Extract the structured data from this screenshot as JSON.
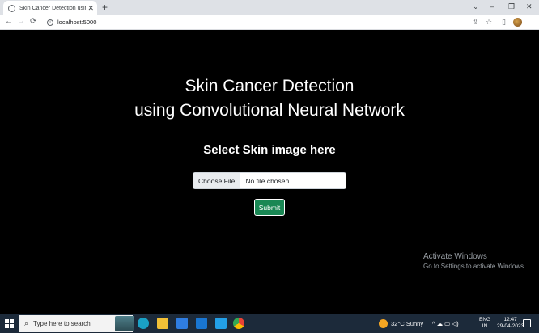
{
  "browser": {
    "tab_title": "Skin Cancer Detection using Co",
    "new_tab": "+",
    "url": "localhost:5000",
    "window_controls": {
      "chevron": "⌄",
      "minimize": "–",
      "restore": "❐",
      "close": "✕"
    },
    "nav": {
      "back": "←",
      "forward": "→",
      "reload": "⟳"
    },
    "toolbar_icons": {
      "share": "⇪",
      "bookmark": "☆",
      "sidebar": "▯",
      "menu": "⋮"
    }
  },
  "page": {
    "heading_line1": "Skin Cancer Detection",
    "heading_line2": "using Convolutional Neural Network",
    "subheading": "Select Skin image here",
    "file_button": "Choose File",
    "file_status": "No file chosen",
    "submit_label": "Submit"
  },
  "watermark": {
    "title": "Activate Windows",
    "subtitle": "Go to Settings to activate Windows."
  },
  "taskbar": {
    "search_placeholder": "Type here to search",
    "weather": "32°C  Sunny",
    "lang_line1": "ENG",
    "lang_line2": "IN",
    "time": "12:47",
    "date": "29-04-2023",
    "tray_icons": "^  ☁  ▭  ◁)",
    "apps": [
      {
        "name": "landscape-icon",
        "color": "#3f6e7a"
      },
      {
        "name": "edge-icon",
        "color": "#1aa1c6"
      },
      {
        "name": "file-explorer-icon",
        "color": "#f2c037"
      },
      {
        "name": "store-icon",
        "color": "#2f7de1"
      },
      {
        "name": "mail-icon",
        "color": "#1976d2"
      },
      {
        "name": "vscode-icon",
        "color": "#23a0e8"
      },
      {
        "name": "chrome-icon",
        "color": "#e94235"
      }
    ]
  },
  "colors": {
    "page_bg": "#000000",
    "submit_bg": "#198754",
    "taskbar_bg": "#1c2a3a"
  }
}
